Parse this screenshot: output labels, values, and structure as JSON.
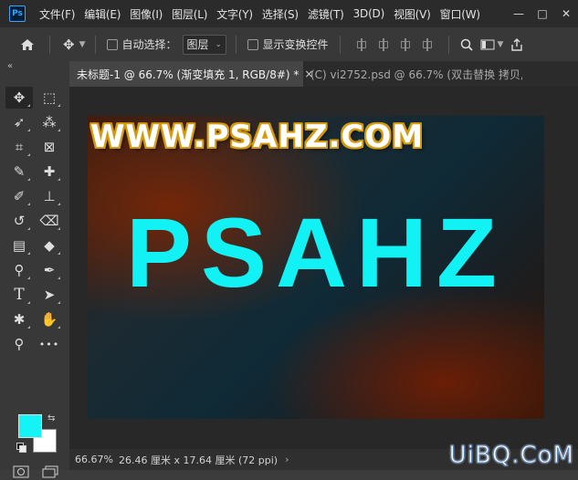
{
  "app": {
    "logo_text": "Ps"
  },
  "menu": [
    "文件(F)",
    "编辑(E)",
    "图像(I)",
    "图层(L)",
    "文字(Y)",
    "选择(S)",
    "滤镜(T)",
    "3D(D)",
    "视图(V)",
    "窗口(W)"
  ],
  "window_controls": {
    "minimize": "—",
    "maximize": "□",
    "close": "✕"
  },
  "options_bar": {
    "auto_select_label": "自动选择：",
    "layer_select_value": "图层",
    "show_transform_label": "显示变换控件"
  },
  "tabs": [
    {
      "label": "未标题-1 @ 66.7% (渐变填充 1, RGB/8#) *",
      "close": "×"
    },
    {
      "label": "(C) vi2752.psd @ 66.7% (双击替换 拷贝,...",
      "close": "×"
    }
  ],
  "canvas": {
    "small_text": "WWW.PSAHZ.COM",
    "big_text": "PSAHZ"
  },
  "colors": {
    "foreground": "#14f3f5",
    "background": "#ffffff",
    "small_text_stroke": "#d49a10",
    "big_text": "#12f1f4"
  },
  "status": {
    "zoom": "66.67%",
    "doc_info": "26.46 厘米 x 17.64 厘米 (72 ppi)",
    "arrow": "›"
  },
  "watermark": "UiBQ.CoM",
  "tools": [
    {
      "icon": "move-icon",
      "glyph": "✥"
    },
    {
      "icon": "rect-marquee-icon",
      "glyph": "⬚"
    },
    {
      "icon": "lasso-icon",
      "glyph": "➶"
    },
    {
      "icon": "magic-wand-icon",
      "glyph": "⁂"
    },
    {
      "icon": "crop-icon",
      "glyph": "⌗"
    },
    {
      "icon": "frame-icon",
      "glyph": "⊠"
    },
    {
      "icon": "eyedropper-icon",
      "glyph": "✎"
    },
    {
      "icon": "healing-brush-icon",
      "glyph": "✚"
    },
    {
      "icon": "brush-icon",
      "glyph": "✐"
    },
    {
      "icon": "clone-stamp-icon",
      "glyph": "⊥"
    },
    {
      "icon": "history-brush-icon",
      "glyph": "↺"
    },
    {
      "icon": "eraser-icon",
      "glyph": "⌫"
    },
    {
      "icon": "gradient-icon",
      "glyph": "▤"
    },
    {
      "icon": "blur-icon",
      "glyph": "◆"
    },
    {
      "icon": "dodge-icon",
      "glyph": "⚲"
    },
    {
      "icon": "pen-icon",
      "glyph": "✒"
    },
    {
      "icon": "type-icon",
      "glyph": "T"
    },
    {
      "icon": "path-select-icon",
      "glyph": "➤"
    },
    {
      "icon": "custom-shape-icon",
      "glyph": "✱"
    },
    {
      "icon": "hand-icon",
      "glyph": "✋"
    },
    {
      "icon": "zoom-icon",
      "glyph": "⚲"
    },
    {
      "icon": "more-tools-icon",
      "glyph": "•••"
    }
  ]
}
